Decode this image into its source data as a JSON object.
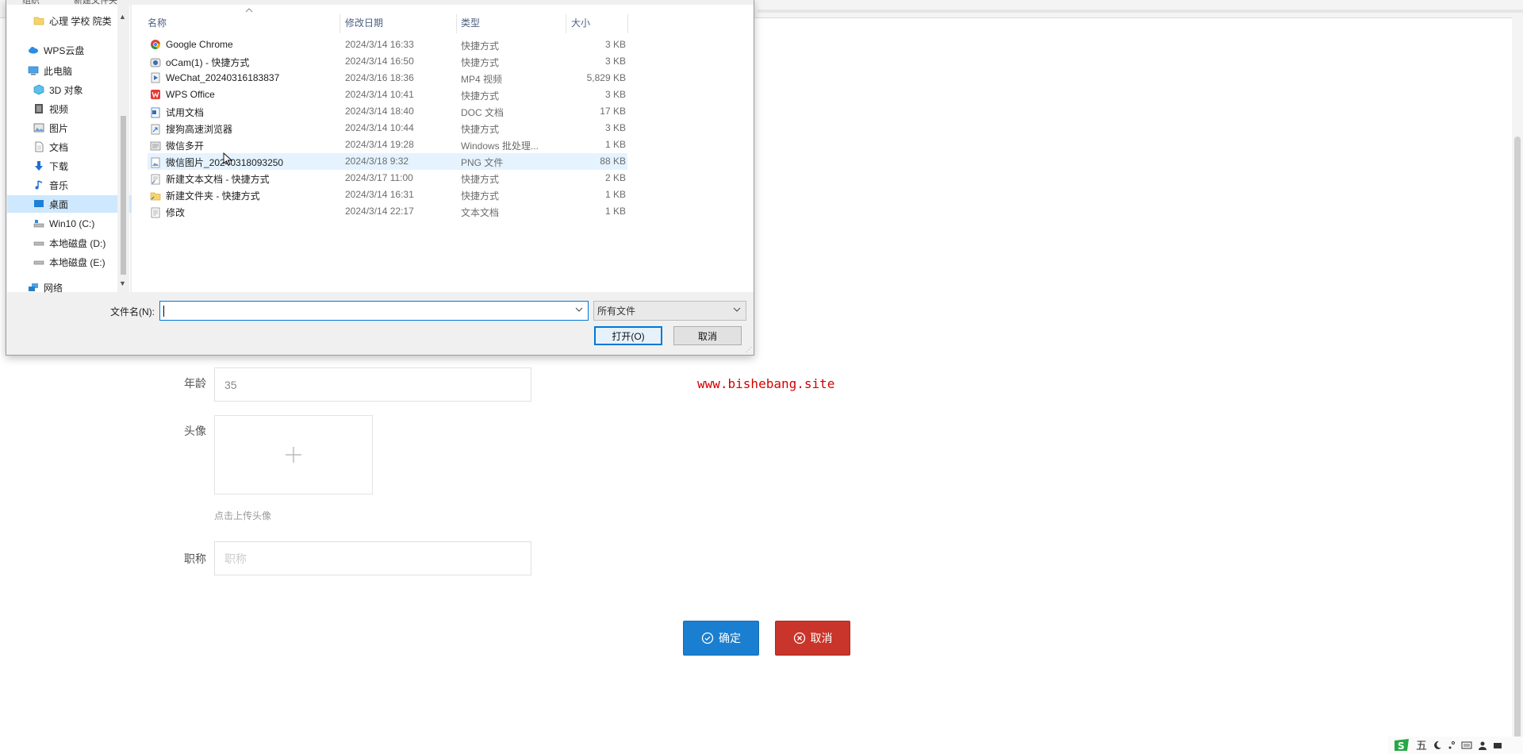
{
  "form": {
    "age_label": "年龄",
    "age_value": "35",
    "avatar_label": "头像",
    "avatar_hint": "点击上传头像",
    "title_label": "职称",
    "title_placeholder": "职称",
    "confirm_label": "确定",
    "cancel_label": "取消"
  },
  "watermark": "www.bishebang.site",
  "dialog": {
    "top_partial": [
      "组织",
      "新建文件夹"
    ],
    "nav": [
      {
        "label": "心理 学校 院类",
        "icon": "folder-icon"
      },
      {
        "label": "WPS云盘",
        "icon": "cloud-icon"
      },
      {
        "label": "此电脑",
        "icon": "computer-icon"
      },
      {
        "label": "3D 对象",
        "icon": "cube-icon"
      },
      {
        "label": "视频",
        "icon": "video-icon"
      },
      {
        "label": "图片",
        "icon": "picture-icon"
      },
      {
        "label": "文档",
        "icon": "document-icon"
      },
      {
        "label": "下载",
        "icon": "download-icon"
      },
      {
        "label": "音乐",
        "icon": "music-icon"
      },
      {
        "label": "桌面",
        "icon": "desktop-icon",
        "selected": true
      },
      {
        "label": "Win10 (C:)",
        "icon": "system-drive-icon"
      },
      {
        "label": "本地磁盘 (D:)",
        "icon": "drive-icon"
      },
      {
        "label": "本地磁盘 (E:)",
        "icon": "drive-icon"
      },
      {
        "label": "网络",
        "icon": "network-icon"
      }
    ],
    "columns": {
      "name": "名称",
      "date": "修改日期",
      "type": "类型",
      "size": "大小"
    },
    "files": [
      {
        "name": "Google Chrome",
        "date": "2024/3/14 16:33",
        "type": "快捷方式",
        "size": "3 KB",
        "icon": "chrome-icon"
      },
      {
        "name": "oCam(1) - 快捷方式",
        "date": "2024/3/14 16:50",
        "type": "快捷方式",
        "size": "3 KB",
        "icon": "ocam-icon"
      },
      {
        "name": "WeChat_20240316183837",
        "date": "2024/3/16 18:36",
        "type": "MP4 视频",
        "size": "5,829 KB",
        "icon": "video-file-icon"
      },
      {
        "name": "WPS Office",
        "date": "2024/3/14 10:41",
        "type": "快捷方式",
        "size": "3 KB",
        "icon": "wps-icon"
      },
      {
        "name": "试用文档",
        "date": "2024/3/14 18:40",
        "type": "DOC 文档",
        "size": "17 KB",
        "icon": "doc-file-icon"
      },
      {
        "name": "搜狗高速浏览器",
        "date": "2024/3/14 10:44",
        "type": "快捷方式",
        "size": "3 KB",
        "icon": "shortcut-icon"
      },
      {
        "name": "微信多开",
        "date": "2024/3/14 19:28",
        "type": "Windows 批处理...",
        "size": "1 KB",
        "icon": "batch-file-icon"
      },
      {
        "name": "微信图片_20240318093250",
        "date": "2024/3/18 9:32",
        "type": "PNG 文件",
        "size": "88 KB",
        "icon": "image-file-icon",
        "hover": true
      },
      {
        "name": "新建文本文档 - 快捷方式",
        "date": "2024/3/17 11:00",
        "type": "快捷方式",
        "size": "2 KB",
        "icon": "text-shortcut-icon"
      },
      {
        "name": "新建文件夹 - 快捷方式",
        "date": "2024/3/14 16:31",
        "type": "快捷方式",
        "size": "1 KB",
        "icon": "folder-shortcut-icon"
      },
      {
        "name": "修改",
        "date": "2024/3/14 22:17",
        "type": "文本文档",
        "size": "1 KB",
        "icon": "text-file-icon"
      }
    ],
    "filename_label": "文件名(N):",
    "filename_value": "",
    "filter_value": "所有文件",
    "open_label": "打开(O)",
    "cancel_label": "取消"
  },
  "tray": {
    "ime_char": "五",
    "items": [
      "moon-icon",
      "punctuation-icon",
      "keyboard-icon",
      "user-icon",
      "settings-icon"
    ]
  },
  "colors": {
    "accent_blue": "#1a7fd0",
    "danger_red": "#c9352a",
    "watermark_red": "#d40000",
    "selection_blue": "#cde8ff"
  }
}
